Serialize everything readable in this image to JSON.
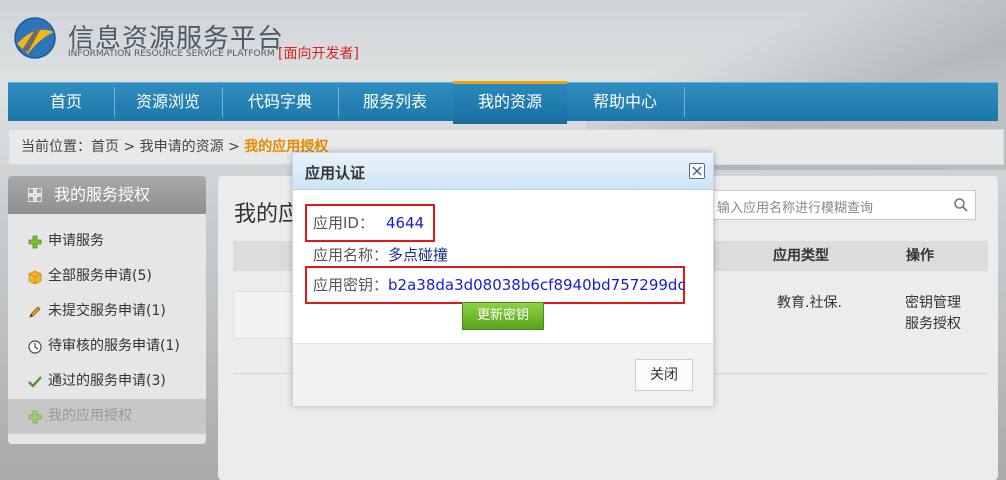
{
  "header": {
    "title": "信息资源服务平台",
    "subtitle": "INFORMATION RESOURCE SERVICE PLATFORM",
    "developer_tag": "[面向开发者]"
  },
  "nav": {
    "items": [
      {
        "label": "首页"
      },
      {
        "label": "资源浏览"
      },
      {
        "label": "代码字典"
      },
      {
        "label": "服务列表"
      },
      {
        "label": "我的资源",
        "active": true
      },
      {
        "label": "帮助中心"
      }
    ],
    "active_border_color": "#f0a20c"
  },
  "breadcrumb": {
    "prefix": "当前位置：",
    "home": "首页",
    "sep1": " > ",
    "level2": "我申请的资源",
    "sep2": " > ",
    "current": "我的应用授权"
  },
  "sidebar": {
    "title": "我的服务授权",
    "items": [
      {
        "label": "申请服务",
        "icon": "plus-icon"
      },
      {
        "label": "全部服务申请(5)",
        "icon": "box-icon"
      },
      {
        "label": "未提交服务申请(1)",
        "icon": "pencil-icon"
      },
      {
        "label": "待审核的服务申请(1)",
        "icon": "clock-icon"
      },
      {
        "label": "通过的服务申请(3)",
        "icon": "check-icon"
      },
      {
        "label": "我的应用授权",
        "icon": "plus-icon",
        "active": true
      }
    ]
  },
  "main": {
    "title": "我的应",
    "search_placeholder": "输入应用名称进行模糊查询",
    "columns": {
      "type": "应用类型",
      "action": "操作"
    },
    "row": {
      "type": "教育.社保.",
      "action1": "密钥管理",
      "action2": "服务授权"
    }
  },
  "modal": {
    "title": "应用认证",
    "app_id_label": "应用ID：",
    "app_id_value": "4644",
    "app_name_label": "应用名称：",
    "app_name_value": "多点碰撞",
    "app_key_label": "应用密钥：",
    "app_key_value": "b2a38da3d08038b6cf8940bd757299dc",
    "renew_label": "更新密钥",
    "close_label": "关闭"
  }
}
